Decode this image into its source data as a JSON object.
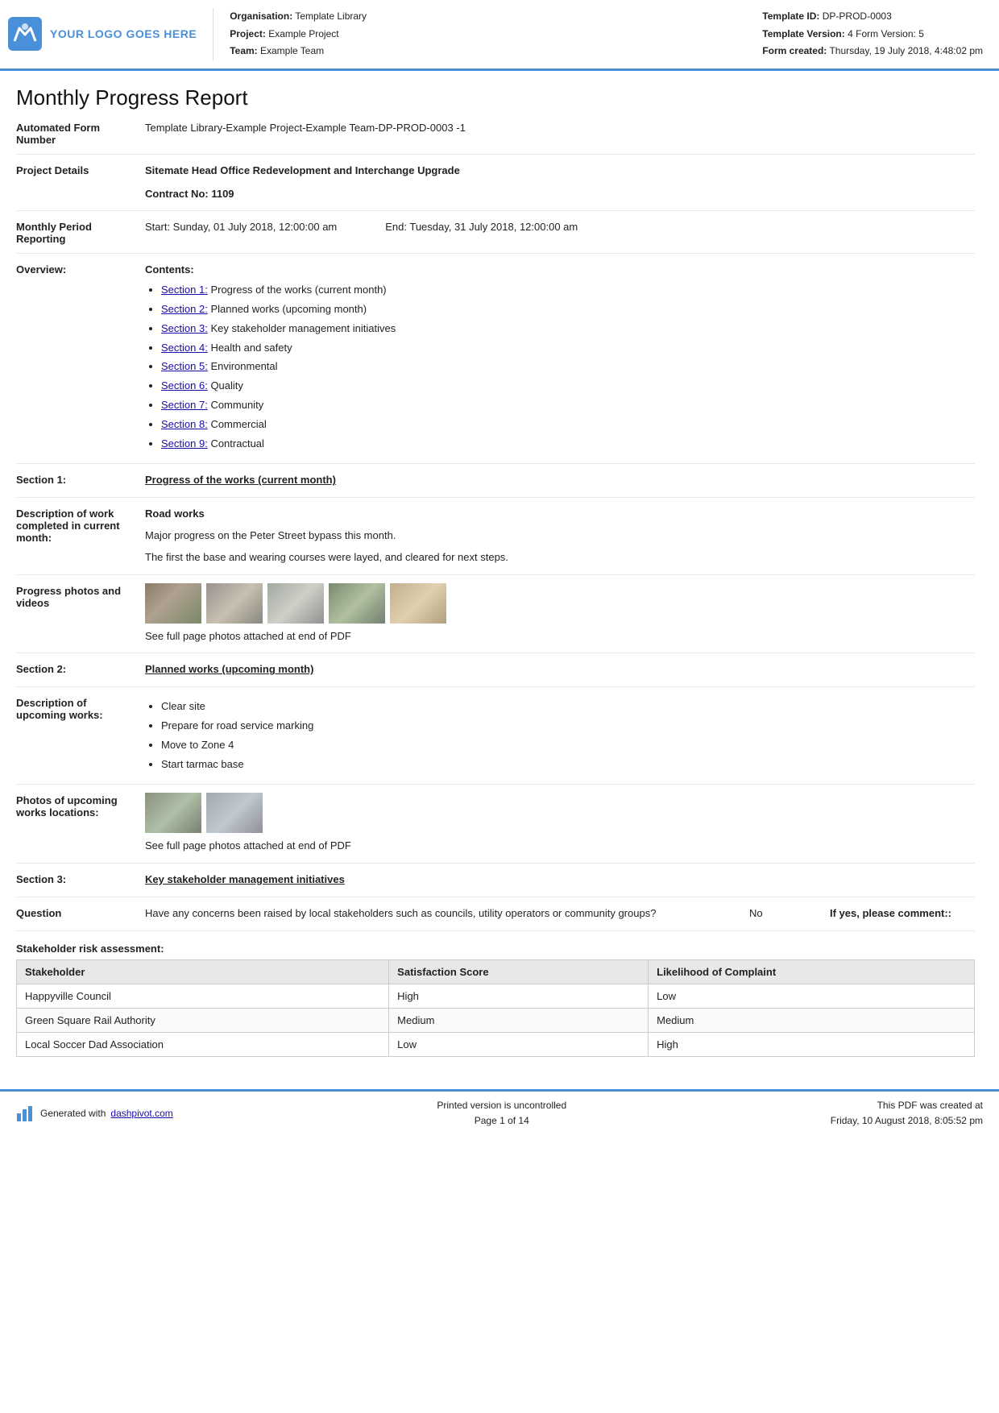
{
  "header": {
    "logo_text": "YOUR LOGO GOES HERE",
    "org_label": "Organisation:",
    "org_value": "Template Library",
    "project_label": "Project:",
    "project_value": "Example Project",
    "team_label": "Team:",
    "team_value": "Example Team",
    "template_id_label": "Template ID:",
    "template_id_value": "DP-PROD-0003",
    "template_version_label": "Template Version:",
    "template_version_value": "4",
    "form_version_label": "Form Version:",
    "form_version_value": "5",
    "form_created_label": "Form created:",
    "form_created_value": "Thursday, 19 July 2018, 4:48:02 pm"
  },
  "report": {
    "title": "Monthly Progress Report",
    "automated_form_label": "Automated Form Number",
    "automated_form_value": "Template Library-Example Project-Example Team-DP-PROD-0003  -1",
    "project_details_label": "Project Details",
    "project_details_value": "Sitemate Head Office Redevelopment and Interchange Upgrade",
    "contract_no_value": "Contract No: 1109",
    "monthly_period_label": "Monthly Period Reporting",
    "period_start": "Start: Sunday, 01 July 2018, 12:00:00 am",
    "period_end": "End: Tuesday, 31 July 2018, 12:00:00 am",
    "overview_label": "Overview:",
    "contents_label": "Contents:",
    "contents_items": [
      {
        "link": "Section 1:",
        "text": " Progress of the works (current month)"
      },
      {
        "link": "Section 2:",
        "text": " Planned works (upcoming month)"
      },
      {
        "link": "Section 3:",
        "text": " Key stakeholder management initiatives"
      },
      {
        "link": "Section 4:",
        "text": " Health and safety"
      },
      {
        "link": "Section 5:",
        "text": " Environmental"
      },
      {
        "link": "Section 6:",
        "text": " Quality"
      },
      {
        "link": "Section 7:",
        "text": " Community"
      },
      {
        "link": "Section 8:",
        "text": " Commercial"
      },
      {
        "link": "Section 9:",
        "text": " Contractual"
      }
    ],
    "section1_label": "Section 1:",
    "section1_heading": "Progress of the works (current month)",
    "desc_work_label": "Description of work completed in current month:",
    "desc_work_heading": "Road works",
    "desc_work_line1": "Major progress on the Peter Street bypass this month.",
    "desc_work_line2": "The first the base and wearing courses were layed, and cleared for next steps.",
    "progress_photos_label": "Progress photos and videos",
    "photos_caption": "See full page photos attached at end of PDF",
    "section2_label": "Section 2:",
    "section2_heading": "Planned works (upcoming month)",
    "upcoming_works_label": "Description of upcoming works:",
    "upcoming_works_items": [
      "Clear site",
      "Prepare for road service marking",
      "Move to Zone 4",
      "Start tarmac base"
    ],
    "photos_upcoming_label": "Photos of upcoming works locations:",
    "photos_upcoming_caption": "See full page photos attached at end of PDF",
    "section3_label": "Section 3:",
    "section3_heading": "Key stakeholder management initiatives",
    "question_label": "Question",
    "question_text": "Have any concerns been raised by local stakeholders such as councils, utility operators or community groups?",
    "question_answer": "No",
    "question_comment": "If yes, please comment::",
    "stakeholder_title": "Stakeholder risk assessment:",
    "table_headers": [
      "Stakeholder",
      "Satisfaction Score",
      "Likelihood of Complaint"
    ],
    "table_rows": [
      [
        "Happyville Council",
        "High",
        "Low"
      ],
      [
        "Green Square Rail Authority",
        "Medium",
        "Medium"
      ],
      [
        "Local Soccer Dad Association",
        "Low",
        "High"
      ]
    ]
  },
  "footer": {
    "generated_text": "Generated with ",
    "dashpivot_link": "dashpivot.com",
    "page_info": "Printed version is uncontrolled",
    "page_number": "Page 1 of 14",
    "pdf_created": "This PDF was created at",
    "pdf_date": "Friday, 10 August 2018, 8:05:52 pm"
  }
}
